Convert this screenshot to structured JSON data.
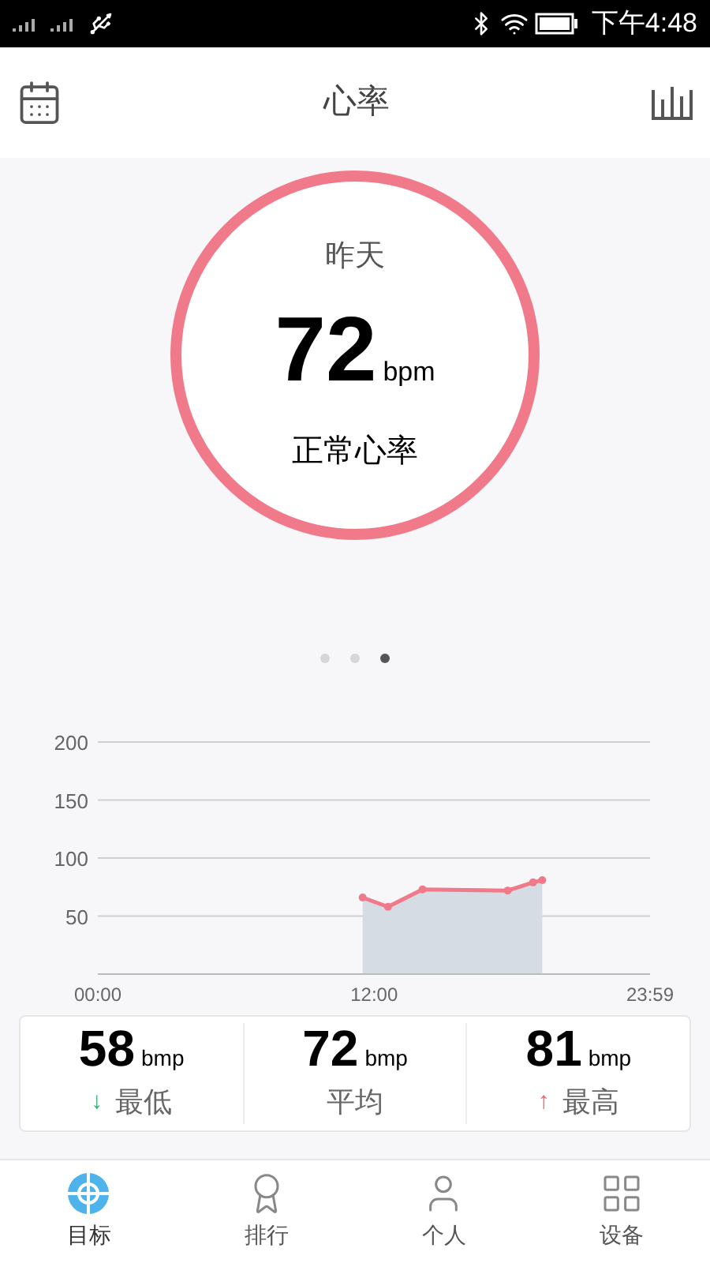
{
  "status_bar": {
    "time": "下午4:48"
  },
  "header": {
    "title": "心率"
  },
  "summary": {
    "period": "昨天",
    "value": "72",
    "unit": "bpm",
    "status": "正常心率"
  },
  "pager": [
    {
      "selected": false
    },
    {
      "selected": false
    },
    {
      "selected": true
    }
  ],
  "chart_data": {
    "type": "area",
    "grid": true,
    "x": [
      11.5,
      12.6,
      14.1,
      17.8,
      18.9,
      19.3
    ],
    "series": [
      {
        "color": "#f07a8a",
        "values": [
          66,
          58,
          73,
          72,
          79,
          81
        ]
      }
    ],
    "xlim": [
      0,
      23.98
    ],
    "ylim": [
      0,
      200
    ],
    "xticks": [
      {
        "value": 0,
        "label": "00:00"
      },
      {
        "value": 12,
        "label": "12:00"
      },
      {
        "value": 23.98,
        "label": "23:59"
      }
    ],
    "yticks": [
      50,
      100,
      150,
      200
    ]
  },
  "stats": [
    {
      "value": "58",
      "unit": "bmp",
      "label": "最低",
      "arrow": "↓",
      "kind": "low"
    },
    {
      "value": "72",
      "unit": "bmp",
      "label": "平均",
      "kind": "plain"
    },
    {
      "value": "81",
      "unit": "bmp",
      "label": "最高",
      "arrow": "↑",
      "kind": "high"
    }
  ],
  "nav": [
    {
      "label": "目标",
      "selected": true
    },
    {
      "label": "排行",
      "selected": false
    },
    {
      "label": "个人",
      "selected": false
    },
    {
      "label": "设备",
      "selected": false
    }
  ]
}
